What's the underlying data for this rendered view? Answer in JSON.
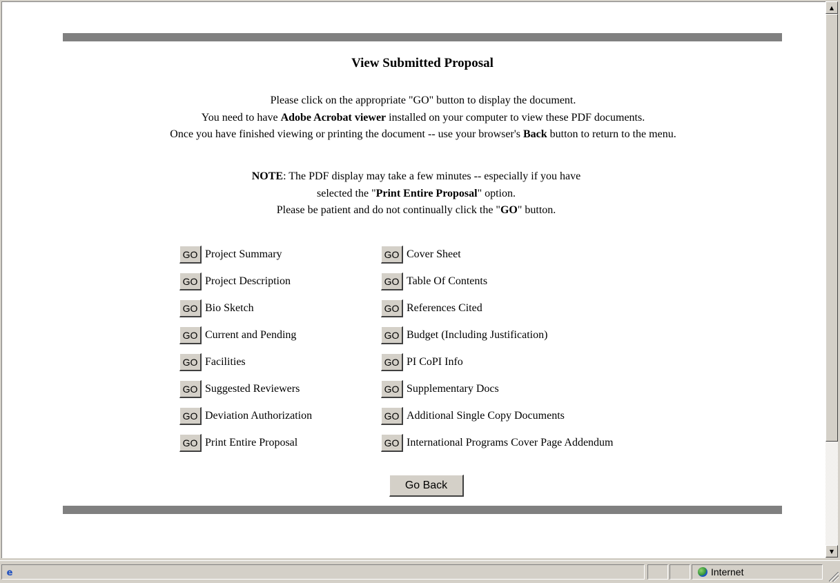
{
  "page": {
    "title": "View Submitted Proposal",
    "intro": [
      "Please click on the appropriate \"GO\" button to display the document.",
      "You need to have [Adobe Acrobat viewer] installed on your computer to view these PDF documents.",
      "Once you have finished viewing or printing the document -- use your browser's [Back] button to return to the menu."
    ],
    "note": [
      "[NOTE]: The PDF display may take a few minutes -- especially if you have",
      "selected the \"[Print Entire Proposal]\" option.",
      "Please be patient and do not continually click the \"[GO]\" button."
    ],
    "go_label": "GO",
    "left_items": [
      "Project Summary",
      "Project Description",
      "Bio Sketch",
      "Current and Pending",
      "Facilities",
      "Suggested Reviewers",
      "Deviation Authorization",
      "Print Entire Proposal"
    ],
    "right_items": [
      "Cover Sheet",
      "Table Of Contents",
      "References Cited",
      "Budget (Including Justification)",
      "PI CoPI Info",
      "Supplementary Docs",
      "Additional Single Copy Documents",
      "International Programs Cover Page Addendum"
    ],
    "go_back_label": "Go Back"
  },
  "statusbar": {
    "zone_label": "Internet",
    "zone_icon": "globe-icon",
    "page_icon": "ie-page-icon"
  },
  "scrollbar": {
    "up_icon": "scroll-up-arrow-icon",
    "down_icon": "scroll-down-arrow-icon"
  }
}
